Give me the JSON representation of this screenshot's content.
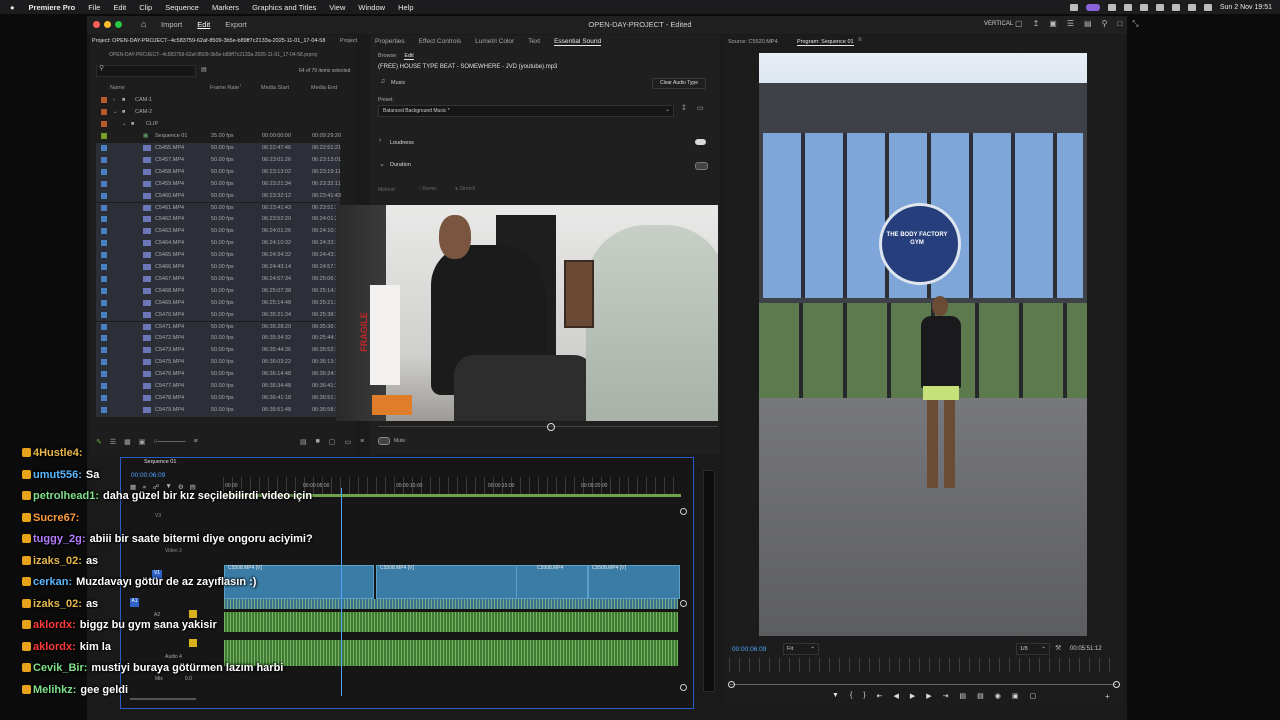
{
  "menubar": {
    "apple": "",
    "app_name": "Premiere Pro",
    "items": [
      "File",
      "Edit",
      "Clip",
      "Sequence",
      "Markers",
      "Graphics and Titles",
      "View",
      "Window",
      "Help"
    ],
    "datetime": "Sun 2 Nov  19:51"
  },
  "app": {
    "workspace_tabs": [
      "Import",
      "Edit",
      "Export"
    ],
    "active_workspace": "Edit",
    "document_title": "OPEN-DAY-PROJECT - Edited",
    "workspace_label": "VERTICAL"
  },
  "project": {
    "tab_label": "Project: OPEN-DAY-PROJECT--4c583759-62af-8509-3b5e-b89ff7c2133a-2025-11-01_17-04-58",
    "tab_label_2": "Project",
    "file_name": "OPEN-DAY-PROJECT--4c583759-62af-8509-3b5e-b89ff7c2133a-2025-11-01_17-04-58.prproj",
    "items_selected": "64 of 79 items selected",
    "columns": [
      "Name",
      "Frame Rate",
      "Media Start",
      "Media End"
    ],
    "folders": [
      {
        "name": "CAM-1",
        "color": "#c0672f"
      },
      {
        "name": "CAM-2",
        "color": "#c0672f"
      },
      {
        "name": "CLIP",
        "color": "#c0672f"
      }
    ],
    "sequence_row": {
      "name": "Sequence 01",
      "fps": "25.00 fps",
      "start": "00:00:00:00",
      "end": "00:09:29:20"
    },
    "rows": [
      {
        "name": "C5455.MP4",
        "fps": "50.00 fps",
        "start": "06:22:47:46",
        "end": "06:22:51:21"
      },
      {
        "name": "C5457.MP4",
        "fps": "50.00 fps",
        "start": "06:23:01:26",
        "end": "06:23:13:01"
      },
      {
        "name": "C5458.MP4",
        "fps": "50.00 fps",
        "start": "06:23:13:02",
        "end": "06:23:19:11"
      },
      {
        "name": "C5459.MP4",
        "fps": "50.00 fps",
        "start": "06:23:21:34",
        "end": "06:23:32:11"
      },
      {
        "name": "C5460.MP4",
        "fps": "50.00 fps",
        "start": "06:23:32:12",
        "end": "06:23:41:43"
      },
      {
        "name": "C5461.MP4",
        "fps": "50.00 fps",
        "start": "06:23:41:43",
        "end": "06:23:51:11"
      },
      {
        "name": "C5462.MP4",
        "fps": "50.00 fps",
        "start": "06:23:52:20",
        "end": "06:24:01:22"
      },
      {
        "name": "C5463.MP4",
        "fps": "50.00 fps",
        "start": "06:24:01:26",
        "end": "06:24:10:11"
      },
      {
        "name": "C5464.MP4",
        "fps": "50.00 fps",
        "start": "06:24:10:32",
        "end": "06:24:33:11"
      },
      {
        "name": "C5465.MP4",
        "fps": "50.00 fps",
        "start": "06:24:34:32",
        "end": "06:24:43:11"
      },
      {
        "name": "C5466.MP4",
        "fps": "50.00 fps",
        "start": "06:24:43:14",
        "end": "06:24:57:11"
      },
      {
        "name": "C5467.MP4",
        "fps": "50.00 fps",
        "start": "06:24:57:34",
        "end": "06:25:06:11"
      },
      {
        "name": "C5468.MP4",
        "fps": "50.00 fps",
        "start": "06:25:07:38",
        "end": "06:25:14:11"
      },
      {
        "name": "C5469.MP4",
        "fps": "50.00 fps",
        "start": "06:25:14:48",
        "end": "06:25:21:11"
      },
      {
        "name": "C5470.MP4",
        "fps": "50.00 fps",
        "start": "06:35:21:34",
        "end": "06:25:38:11"
      },
      {
        "name": "C5471.MP4",
        "fps": "50.00 fps",
        "start": "06:35:28:20",
        "end": "06:35:36:11"
      },
      {
        "name": "C5472.MP4",
        "fps": "50.00 fps",
        "start": "06:35:34:32",
        "end": "06:25:44:11"
      },
      {
        "name": "C5473.MP4",
        "fps": "50.00 fps",
        "start": "06:35:44:36",
        "end": "06:35:52:11"
      },
      {
        "name": "C5475.MP4",
        "fps": "50.00 fps",
        "start": "06:36:03:22",
        "end": "06:36:13:11"
      },
      {
        "name": "C5476.MP4",
        "fps": "50.00 fps",
        "start": "06:36:14:48",
        "end": "06:36:24:11"
      },
      {
        "name": "C5477.MP4",
        "fps": "50.00 fps",
        "start": "06:36:34:48",
        "end": "06:36:41:11"
      },
      {
        "name": "C5478.MP4",
        "fps": "50.00 fps",
        "start": "06:36:41:18",
        "end": "06:36:51:11"
      },
      {
        "name": "C5479.MP4",
        "fps": "50.00 fps",
        "start": "06:36:51:48",
        "end": "06:36:58:11"
      }
    ]
  },
  "effects": {
    "tabs": [
      "Properties",
      "Effect Controls",
      "Lumetri Color",
      "Text",
      "Essential Sound"
    ],
    "active_tab": "Essential Sound",
    "subtabs": [
      "Browse",
      "Edit"
    ],
    "clip_title": "(FREE) HOUSE TYPE BEAT - SOMEWHERE - JVD (youtube).mp3",
    "audio_type": "Music",
    "clear_button": "Clear Audio Type",
    "preset_label": "Preset:",
    "preset_value": "Balanced Background Music *",
    "loudness": "Loudness",
    "duration": "Duration",
    "method_label": "Method",
    "method_options": [
      "Remix",
      "Stretch"
    ],
    "mute_label": "Mute"
  },
  "source": {
    "tab_source": "Source: C5520.MP4",
    "tab_program": "Program: Sequence 01",
    "sign_text": "FRAGILE"
  },
  "program": {
    "timecode": "00:00:06:09",
    "fit": "Fit",
    "resolution": "1/8",
    "duration": "00:05:51:12",
    "gym_sign": "THE BODY FACTORY GYM"
  },
  "timeline": {
    "sequence_tab": "Sequence 01",
    "timecode": "00:00:06:09",
    "ruler": [
      "00:00",
      "00:00:05:00",
      "00:00:10:00",
      "00:00:15:00",
      "00:00:20:00"
    ],
    "tracks": [
      "V3",
      "V2",
      "V1",
      "A1",
      "A2",
      "A3",
      "Audio 4",
      "Mix"
    ],
    "track_label_v2": "Video 2",
    "clips": [
      "C5508.MP4 [V]",
      "C5508.MP4 [V]",
      "C5508.MP4",
      "C5508.MP4 [V]"
    ],
    "mix_value": "0.0"
  },
  "chat": [
    {
      "user": "4Hustle4:",
      "msg": "",
      "color": "#e8b84a"
    },
    {
      "user": "umut556:",
      "msg": "Sa",
      "color": "#5bb8ff"
    },
    {
      "user": "petrolhead1:",
      "msg": "daha güzel bir kız seçilebilirdi video için",
      "color": "#7ee08a"
    },
    {
      "user": "Sucre67:",
      "msg": "",
      "color": "#ff9c3f"
    },
    {
      "user": "tuggy_2g:",
      "msg": "abiii bir saate bitermi diye ongoru aciyimi?",
      "color": "#b67cff"
    },
    {
      "user": "izaks_02:",
      "msg": "as",
      "color": "#e8b84a"
    },
    {
      "user": "cerkan:",
      "msg": "Muzdavayı götür de az zayıflasın :)",
      "color": "#5bb8ff"
    },
    {
      "user": "izaks_02:",
      "msg": "as",
      "color": "#e8b84a"
    },
    {
      "user": "aklordx:",
      "msg": "biggz bu gym sana yakisir",
      "color": "#ff3b3b"
    },
    {
      "user": "aklordx:",
      "msg": "kim la",
      "color": "#ff3b3b"
    },
    {
      "user": "Cevik_Bir:",
      "msg": "mustiyi buraya götürmen lazım harbi",
      "color": "#7ee08a"
    },
    {
      "user": "Melihkz:",
      "msg": "gee geldi",
      "color": "#7ee08a"
    }
  ]
}
